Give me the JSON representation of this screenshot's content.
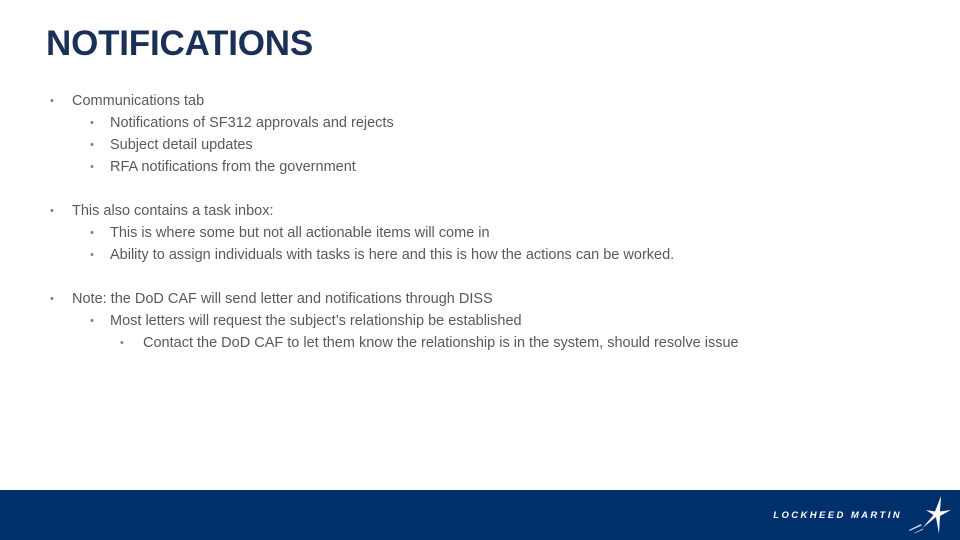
{
  "slide": {
    "title": "NOTIFICATIONS",
    "title_color": "#1b3057",
    "background_color": "#ffffff",
    "body_text_color": "#595959"
  },
  "body": {
    "groups": [
      {
        "bullets": [
          {
            "level": 1,
            "marker": "•",
            "text": "Communications tab"
          },
          {
            "level": 2,
            "marker": "•",
            "text": "Notifications of SF312 approvals and rejects"
          },
          {
            "level": 2,
            "marker": "•",
            "text": "Subject detail updates"
          },
          {
            "level": 2,
            "marker": "•",
            "text": "RFA notifications from the government"
          }
        ]
      },
      {
        "bullets": [
          {
            "level": 1,
            "marker": "•",
            "text": "This also contains a task inbox:"
          },
          {
            "level": 2,
            "marker": "•",
            "text": "This is where some but not all actionable items will come in"
          },
          {
            "level": 2,
            "marker": "•",
            "text": "Ability to assign individuals with tasks is here and this is how the actions can be worked."
          }
        ]
      },
      {
        "bullets": [
          {
            "level": 1,
            "marker": "•",
            "text": "Note: the DoD CAF will send letter and notifications through DISS"
          },
          {
            "level": 2,
            "marker": "•",
            "text": "Most letters will request the subject’s relationship be established"
          },
          {
            "level": 3,
            "marker": "•",
            "text": "Contact the DoD CAF to let them know the relationship is in the system, should resolve issue"
          }
        ]
      }
    ]
  },
  "footer": {
    "background_color": "#00306b",
    "logo_wordmark": "LOCKHEED MARTIN",
    "logo_icon": "lockheed-martin-star-icon"
  }
}
